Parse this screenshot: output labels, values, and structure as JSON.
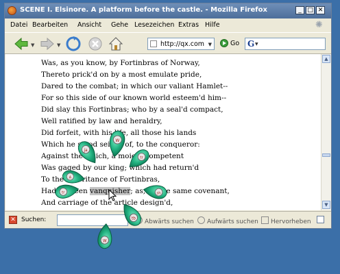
{
  "window": {
    "title": "SCENE I. Elsinore. A platform before the castle. - Mozilla Firefox",
    "controls": [
      "_",
      "□",
      "✕"
    ]
  },
  "menubar": {
    "items": [
      "Datei",
      "Bearbeiten",
      "Ansicht",
      "Gehe",
      "Lesezeichen",
      "Extras",
      "Hilfe"
    ]
  },
  "toolbar": {
    "url": "http://qx.com",
    "go_label": "Go",
    "search_engine_icon": "G"
  },
  "content": {
    "lines": [
      "Was, as you know, by Fortinbras of Norway,",
      "Thereto prick'd on by a most emulate pride,",
      "Dared to the combat; in which our valiant Hamlet--",
      "For so this side of our known world esteem'd him--",
      "Did slay this Fortinbras; who by a seal'd compact,",
      "Well ratified by law and heraldry,",
      "Did forfeit, with his life, all those his lands",
      "Which he stood seized of, to the conqueror:",
      "Against the which, a moiety competent",
      "Was gaged by our king; which had return'd",
      "To the inheritance of Fortinbras,",
      "Had he been ",
      "; as, by the same covenant,",
      "And carriage of the article design'd,"
    ],
    "highlighted_word": "vanquisher"
  },
  "findbar": {
    "label": "Suchen:",
    "input_value": "",
    "next_label": "Abwärts suchen",
    "prev_label": "Aufwärts suchen",
    "highlight_label": "Hervorheben"
  },
  "pie_menu": {
    "petal_labels": [
      "W",
      "tr",
      "ja",
      "A",
      "tr",
      "sh",
      "tb",
      "W"
    ],
    "accent_color": "#1fa37a"
  },
  "colors": {
    "desktop": "#3b6fa8",
    "titlebar": "#5a7ba6",
    "window": "#ece9d8"
  }
}
